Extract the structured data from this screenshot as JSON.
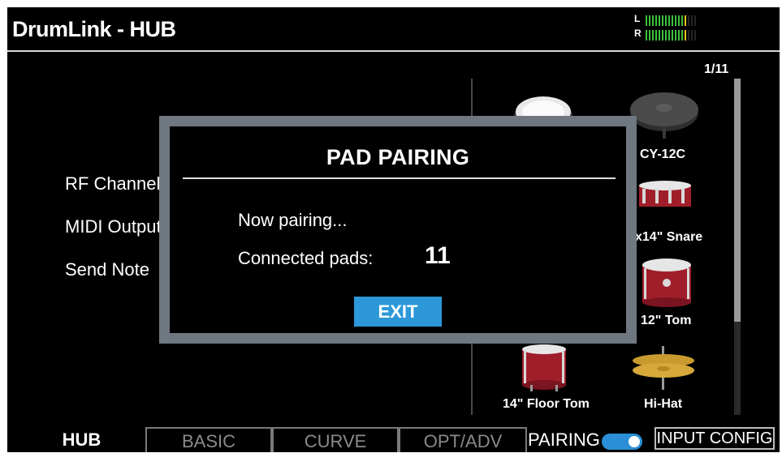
{
  "header": {
    "title": "DrumLink - HUB",
    "meter": {
      "left_label": "L",
      "right_label": "R",
      "left_level": 0.82,
      "right_level": 0.82
    }
  },
  "settings": {
    "items": [
      {
        "label": "RF Channel"
      },
      {
        "label": "MIDI Output"
      },
      {
        "label": "Send Note"
      }
    ]
  },
  "pad_list": {
    "page_indicator": "1/11",
    "pads": [
      {
        "label": "",
        "icon": "mesh-pad-icon"
      },
      {
        "label": "CY-12C",
        "icon": "cymbal-icon"
      },
      {
        "label": "x14\" Snare",
        "icon": "snare-drum-icon"
      },
      {
        "label": "12\" Tom",
        "icon": "tom-drum-icon"
      },
      {
        "label": "14\" Floor Tom",
        "icon": "floor-tom-icon"
      },
      {
        "label": "Hi-Hat",
        "icon": "hi-hat-icon"
      }
    ]
  },
  "tabs": {
    "items": [
      {
        "label": "HUB",
        "active": true
      },
      {
        "label": "BASIC",
        "active": false
      },
      {
        "label": "CURVE",
        "active": false
      },
      {
        "label": "OPT/ADV",
        "active": false
      }
    ],
    "pairing_label": "PAIRING",
    "pairing_on": true,
    "input_config_label": "INPUT CONFIG"
  },
  "dialog": {
    "title": "PAD PAIRING",
    "status": "Now pairing...",
    "connected_label": "Connected pads:",
    "connected_count": "11",
    "exit_label": "EXIT"
  },
  "colors": {
    "accent_blue": "#2c98d8",
    "dialog_frame": "#6f7780",
    "meter_green": "#3fbf3f",
    "meter_yellow": "#e6c81e",
    "drum_red": "#a01e2a"
  }
}
